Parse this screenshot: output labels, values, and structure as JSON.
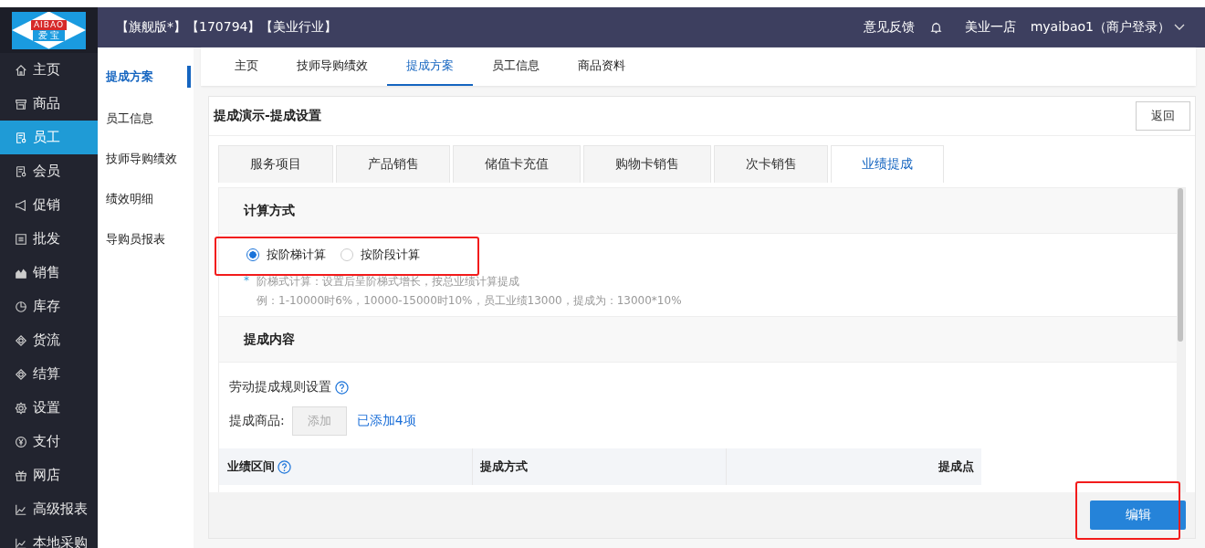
{
  "header": {
    "edition": "【旗舰版*】【170794】【美业行业】",
    "feedback": "意见反馈",
    "store": "美业一店",
    "user": "myaibao1（商户登录）"
  },
  "logo": {
    "top": "AIBAO",
    "bottom": "爱 宝"
  },
  "nav": [
    {
      "label": "主页",
      "kind": "home",
      "selected": false
    },
    {
      "label": "商品",
      "kind": "store",
      "selected": false
    },
    {
      "label": "员工",
      "kind": "doc",
      "selected": true
    },
    {
      "label": "会员",
      "kind": "doc",
      "selected": false
    },
    {
      "label": "促销",
      "kind": "megaphone",
      "selected": false
    },
    {
      "label": "批发",
      "kind": "list",
      "selected": false
    },
    {
      "label": "销售",
      "kind": "area",
      "selected": false
    },
    {
      "label": "库存",
      "kind": "pie",
      "selected": false
    },
    {
      "label": "货流",
      "kind": "cube",
      "selected": false
    },
    {
      "label": "结算",
      "kind": "cube",
      "selected": false
    },
    {
      "label": "设置",
      "kind": "gear",
      "selected": false
    },
    {
      "label": "支付",
      "kind": "yen",
      "selected": false
    },
    {
      "label": "网店",
      "kind": "gift",
      "selected": false
    },
    {
      "label": "高级报表",
      "kind": "line",
      "selected": false
    },
    {
      "label": "本地采购",
      "kind": "line",
      "selected": false
    }
  ],
  "subnav": [
    {
      "label": "提成方案",
      "selected": true
    },
    {
      "label": "员工信息",
      "selected": false
    },
    {
      "label": "技师导购绩效",
      "selected": false
    },
    {
      "label": "绩效明细",
      "selected": false
    },
    {
      "label": "导购员报表",
      "selected": false
    }
  ],
  "page_tabs": [
    {
      "label": "主页",
      "selected": false
    },
    {
      "label": "技师导购绩效",
      "selected": false
    },
    {
      "label": "提成方案",
      "selected": true
    },
    {
      "label": "员工信息",
      "selected": false
    },
    {
      "label": "商品资料",
      "selected": false
    }
  ],
  "panel": {
    "title": "提成演示-提成设置",
    "back": "返回"
  },
  "sub_tabs": [
    {
      "label": "服务项目",
      "selected": false
    },
    {
      "label": "产品销售",
      "selected": false
    },
    {
      "label": "储值卡充值",
      "selected": false
    },
    {
      "label": "购物卡销售",
      "selected": false
    },
    {
      "label": "次卡销售",
      "selected": false
    },
    {
      "label": "业绩提成",
      "selected": true
    }
  ],
  "calc": {
    "title": "计算方式",
    "options": [
      {
        "label": "按阶梯计算",
        "selected": true
      },
      {
        "label": "按阶段计算",
        "selected": false
      }
    ],
    "note_mark": "*",
    "note": "阶梯式计算：设置后呈阶梯式增长，按总业绩计算提成",
    "example": "例：1-10000时6%，10000-15000时10%，员工业绩13000，提成为：13000*10%"
  },
  "content": {
    "title": "提成内容",
    "rule": "劳动提成规则设置",
    "goods_label": "提成商品:",
    "add": "添加",
    "added": "已添加4项"
  },
  "table": {
    "columns": [
      "业绩区间",
      "提成方式",
      "提成点"
    ]
  },
  "footer": {
    "edit": "编辑"
  }
}
